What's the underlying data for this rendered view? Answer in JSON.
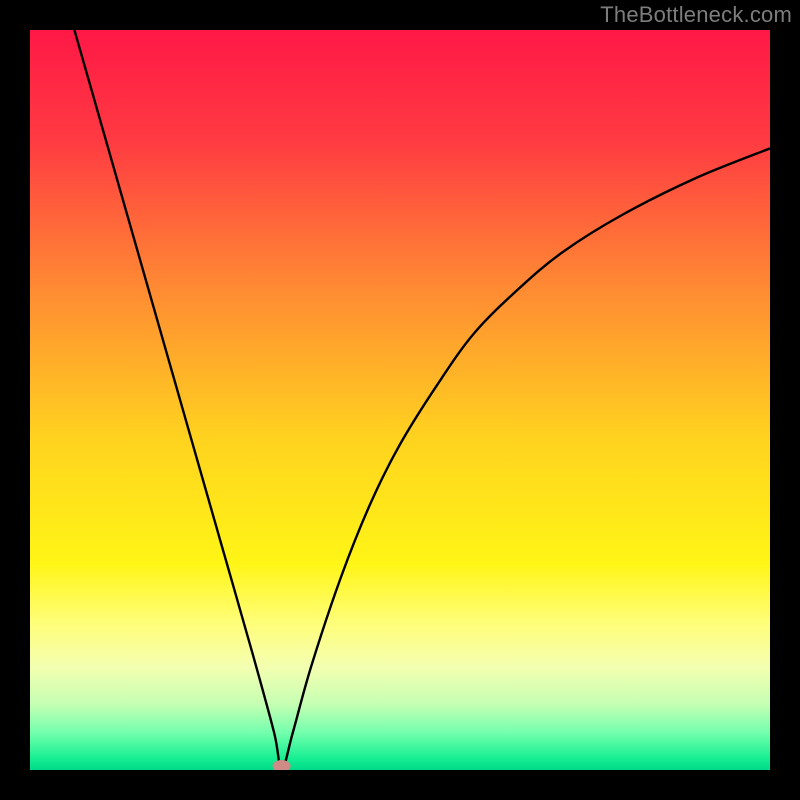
{
  "attribution": "TheBottleneck.com",
  "chart_data": {
    "type": "line",
    "title": "",
    "xlabel": "",
    "ylabel": "",
    "xlim": [
      0,
      100
    ],
    "ylim": [
      0,
      100
    ],
    "optimum_x": 34,
    "series": [
      {
        "name": "bottleneck-curve",
        "x": [
          6,
          10,
          14,
          18,
          22,
          26,
          30,
          33,
          34,
          35.5,
          38,
          42,
          46,
          50,
          55,
          60,
          66,
          72,
          80,
          90,
          100
        ],
        "values": [
          100,
          86,
          72,
          58,
          44,
          30,
          16,
          5,
          0,
          5,
          14,
          26,
          36,
          44,
          52,
          59,
          65,
          70,
          75,
          80,
          84
        ]
      }
    ],
    "marker": {
      "x": 34,
      "y": 0,
      "color": "#cf8b85"
    },
    "background_gradient": {
      "stops": [
        {
          "offset": 0.0,
          "color": "#ff1846"
        },
        {
          "offset": 0.15,
          "color": "#ff3b42"
        },
        {
          "offset": 0.35,
          "color": "#ff8b33"
        },
        {
          "offset": 0.55,
          "color": "#ffd21f"
        },
        {
          "offset": 0.72,
          "color": "#fff516"
        },
        {
          "offset": 0.8,
          "color": "#fffe78"
        },
        {
          "offset": 0.86,
          "color": "#f4ffb0"
        },
        {
          "offset": 0.91,
          "color": "#c7ffb3"
        },
        {
          "offset": 0.95,
          "color": "#72ffad"
        },
        {
          "offset": 0.985,
          "color": "#15ee93"
        },
        {
          "offset": 1.0,
          "color": "#00d989"
        }
      ]
    }
  }
}
